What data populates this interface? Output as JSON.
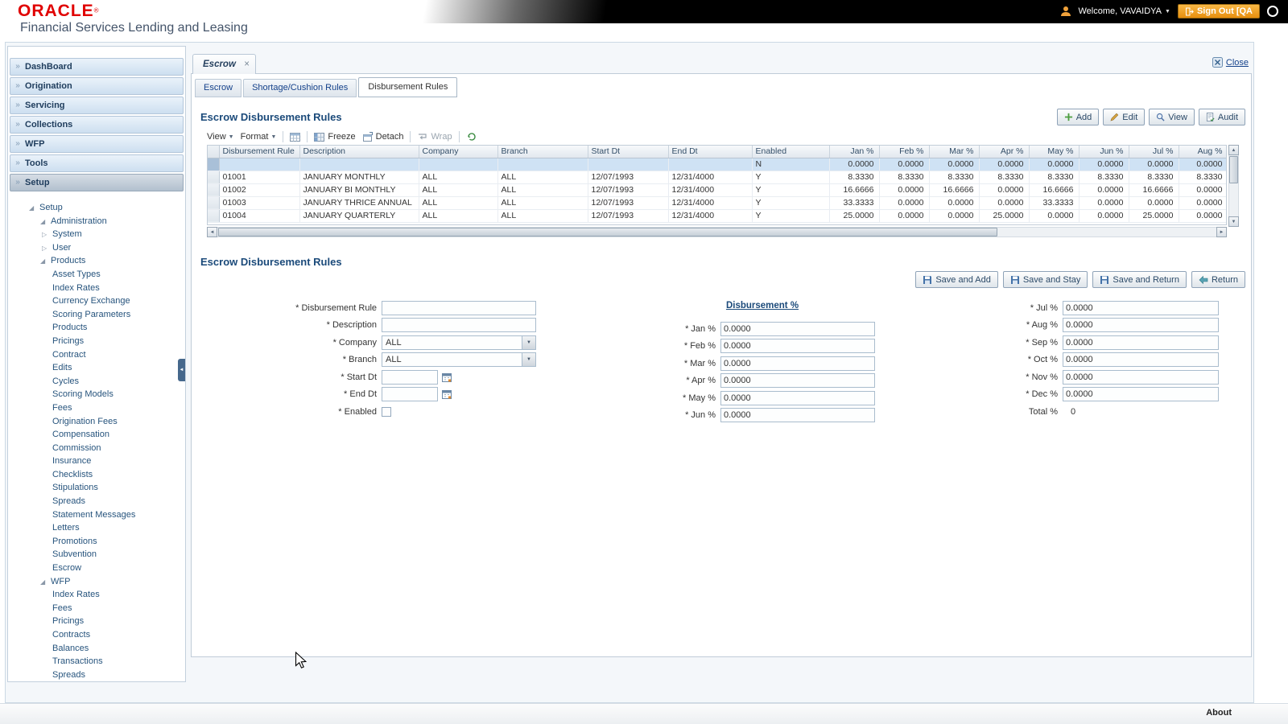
{
  "header": {
    "logo": "ORACLE",
    "logo_registered": "®",
    "subtitle": "Financial Services Lending and Leasing",
    "welcome_label": "Welcome, VAVAIDYA",
    "sign_out_label": "Sign Out [QA",
    "accent_orange": "#f0a13a"
  },
  "icons": {
    "nav_expand": "»",
    "tree_expanded": "◢",
    "tree_collapsed": "▷",
    "menu_caret": "▼",
    "tab_close": "×",
    "scroll_left": "◄",
    "scroll_right": "►",
    "scroll_up": "▲",
    "scroll_down": "▼",
    "collapse_left": "◄"
  },
  "sidebar": {
    "nav": [
      "DashBoard",
      "Origination",
      "Servicing",
      "Collections",
      "WFP",
      "Tools",
      "Setup"
    ],
    "active_nav": "Setup",
    "tree": [
      {
        "label": "Setup",
        "level": 0,
        "state": "expanded"
      },
      {
        "label": "Administration",
        "level": 1,
        "state": "expanded"
      },
      {
        "label": "System",
        "level": 2,
        "state": "collapsed"
      },
      {
        "label": "User",
        "level": 2,
        "state": "collapsed"
      },
      {
        "label": "Products",
        "level": 1,
        "state": "expanded"
      },
      {
        "label": "Asset Types",
        "level": 2,
        "state": "leaf"
      },
      {
        "label": "Index Rates",
        "level": 2,
        "state": "leaf"
      },
      {
        "label": "Currency Exchange",
        "level": 2,
        "state": "leaf"
      },
      {
        "label": "Scoring Parameters",
        "level": 2,
        "state": "leaf"
      },
      {
        "label": "Products",
        "level": 2,
        "state": "leaf"
      },
      {
        "label": "Pricings",
        "level": 2,
        "state": "leaf"
      },
      {
        "label": "Contract",
        "level": 2,
        "state": "leaf"
      },
      {
        "label": "Edits",
        "level": 2,
        "state": "leaf"
      },
      {
        "label": "Cycles",
        "level": 2,
        "state": "leaf"
      },
      {
        "label": "Scoring Models",
        "level": 2,
        "state": "leaf"
      },
      {
        "label": "Fees",
        "level": 2,
        "state": "leaf"
      },
      {
        "label": "Origination Fees",
        "level": 2,
        "state": "leaf"
      },
      {
        "label": "Compensation",
        "level": 2,
        "state": "leaf"
      },
      {
        "label": "Commission",
        "level": 2,
        "state": "leaf"
      },
      {
        "label": "Insurance",
        "level": 2,
        "state": "leaf"
      },
      {
        "label": "Checklists",
        "level": 2,
        "state": "leaf"
      },
      {
        "label": "Stipulations",
        "level": 2,
        "state": "leaf"
      },
      {
        "label": "Spreads",
        "level": 2,
        "state": "leaf"
      },
      {
        "label": "Statement Messages",
        "level": 2,
        "state": "leaf"
      },
      {
        "label": "Letters",
        "level": 2,
        "state": "leaf"
      },
      {
        "label": "Promotions",
        "level": 2,
        "state": "leaf"
      },
      {
        "label": "Subvention",
        "level": 2,
        "state": "leaf"
      },
      {
        "label": "Escrow",
        "level": 2,
        "state": "leaf"
      },
      {
        "label": "WFP",
        "level": 1,
        "state": "expanded"
      },
      {
        "label": "Index Rates",
        "level": 2,
        "state": "leaf"
      },
      {
        "label": "Fees",
        "level": 2,
        "state": "leaf"
      },
      {
        "label": "Pricings",
        "level": 2,
        "state": "leaf"
      },
      {
        "label": "Contracts",
        "level": 2,
        "state": "leaf"
      },
      {
        "label": "Balances",
        "level": 2,
        "state": "leaf"
      },
      {
        "label": "Transactions",
        "level": 2,
        "state": "leaf"
      },
      {
        "label": "Spreads",
        "level": 2,
        "state": "leaf"
      }
    ]
  },
  "window_tab": {
    "label": "Escrow",
    "close_label": "Close"
  },
  "sub_tabs": [
    "Escrow",
    "Shortage/Cushion Rules",
    "Disbursement Rules"
  ],
  "active_sub_tab": "Disbursement Rules",
  "grid_section": {
    "title": "Escrow Disbursement Rules",
    "actions": [
      "Add",
      "Edit",
      "View",
      "Audit"
    ],
    "toolbar": {
      "view": "View",
      "format": "Format",
      "freeze": "Freeze",
      "detach": "Detach",
      "wrap": "Wrap"
    },
    "columns": [
      "Disbursement Rule",
      "Description",
      "Company",
      "Branch",
      "Start Dt",
      "End Dt",
      "Enabled",
      "Jan %",
      "Feb %",
      "Mar %",
      "Apr %",
      "May %",
      "Jun %",
      "Jul %",
      "Aug %"
    ],
    "rows": [
      {
        "selected": true,
        "cells": [
          "",
          "",
          "",
          "",
          "",
          "",
          "N",
          "0.0000",
          "0.0000",
          "0.0000",
          "0.0000",
          "0.0000",
          "0.0000",
          "0.0000",
          "0.0000"
        ]
      },
      {
        "selected": false,
        "cells": [
          "01001",
          "JANUARY MONTHLY",
          "ALL",
          "ALL",
          "12/07/1993",
          "12/31/4000",
          "Y",
          "8.3330",
          "8.3330",
          "8.3330",
          "8.3330",
          "8.3330",
          "8.3330",
          "8.3330",
          "8.3330"
        ]
      },
      {
        "selected": false,
        "cells": [
          "01002",
          "JANUARY BI MONTHLY",
          "ALL",
          "ALL",
          "12/07/1993",
          "12/31/4000",
          "Y",
          "16.6666",
          "0.0000",
          "16.6666",
          "0.0000",
          "16.6666",
          "0.0000",
          "16.6666",
          "0.0000"
        ]
      },
      {
        "selected": false,
        "cells": [
          "01003",
          "JANUARY THRICE ANNUAL",
          "ALL",
          "ALL",
          "12/07/1993",
          "12/31/4000",
          "Y",
          "33.3333",
          "0.0000",
          "0.0000",
          "0.0000",
          "33.3333",
          "0.0000",
          "0.0000",
          "0.0000"
        ]
      },
      {
        "selected": false,
        "cells": [
          "01004",
          "JANUARY QUARTERLY",
          "ALL",
          "ALL",
          "12/07/1993",
          "12/31/4000",
          "Y",
          "25.0000",
          "0.0000",
          "0.0000",
          "25.0000",
          "0.0000",
          "0.0000",
          "25.0000",
          "0.0000"
        ]
      }
    ]
  },
  "form_section": {
    "title": "Escrow Disbursement Rules",
    "buttons": [
      "Save and Add",
      "Save and Stay",
      "Save and Return",
      "Return"
    ],
    "fields": {
      "disbursement_rule_label": "* Disbursement Rule",
      "description_label": "* Description",
      "company_label": "* Company",
      "company_value": "ALL",
      "branch_label": "* Branch",
      "branch_value": "ALL",
      "start_dt_label": "* Start Dt",
      "end_dt_label": "* End Dt",
      "enabled_label": "* Enabled"
    },
    "disbursement_header": "Disbursement %",
    "months_left": [
      {
        "label": "* Jan %",
        "value": "0.0000"
      },
      {
        "label": "* Feb %",
        "value": "0.0000"
      },
      {
        "label": "* Mar %",
        "value": "0.0000"
      },
      {
        "label": "* Apr %",
        "value": "0.0000"
      },
      {
        "label": "* May %",
        "value": "0.0000"
      },
      {
        "label": "* Jun %",
        "value": "0.0000"
      }
    ],
    "months_right": [
      {
        "label": "* Jul %",
        "value": "0.0000"
      },
      {
        "label": "* Aug %",
        "value": "0.0000"
      },
      {
        "label": "* Sep %",
        "value": "0.0000"
      },
      {
        "label": "* Oct %",
        "value": "0.0000"
      },
      {
        "label": "* Nov %",
        "value": "0.0000"
      },
      {
        "label": "* Dec %",
        "value": "0.0000"
      }
    ],
    "total_label": "Total %",
    "total_value": "0"
  },
  "footer": {
    "about": "About"
  }
}
